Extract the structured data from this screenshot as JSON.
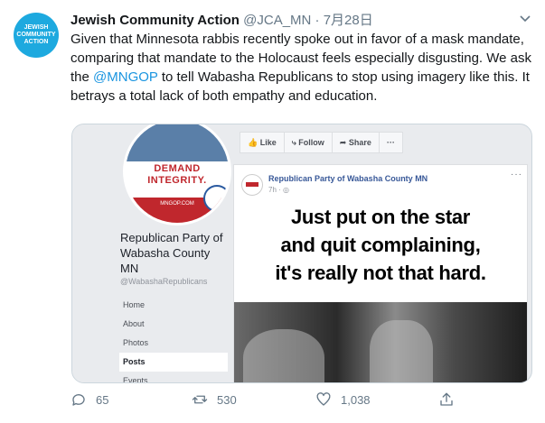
{
  "tweet": {
    "avatar_lines": [
      "JEWISH",
      "COMMUNITY",
      "ACTION"
    ],
    "name": "Jewish Community Action",
    "handle": "@JCA_MN",
    "date": "· 7月28日",
    "text_1": "Given that Minnesota rabbis recently spoke out in favor of a mask mandate, comparing that mandate to the Holocaust feels especially disgusting. We ask the ",
    "mention": "@MNGOP",
    "text_2": " to tell Wabasha Republicans to stop using imagery like this. It betrays a total lack of both empathy and education."
  },
  "fb": {
    "profile_demand": "DEMAND",
    "profile_integrity": "INTEGRITY.",
    "profile_url_snippet": "MNGOP.COM",
    "page_name": "Republican Party of Wabasha County MN",
    "page_handle": "@WabashaRepublicans",
    "nav": [
      "Home",
      "About",
      "Photos",
      "Posts",
      "Events"
    ],
    "buttons": [
      "Like",
      "Follow",
      "Share",
      "···"
    ],
    "post": {
      "page": "Republican Party of Wabasha County MN",
      "time": "7h · ◎",
      "more": "···",
      "meme_line1": "Just put on the star",
      "meme_line2": "and quit complaining,",
      "meme_line3": "it's really not that hard."
    }
  },
  "actions": {
    "replies": "65",
    "retweets": "530",
    "likes": "1,038"
  }
}
